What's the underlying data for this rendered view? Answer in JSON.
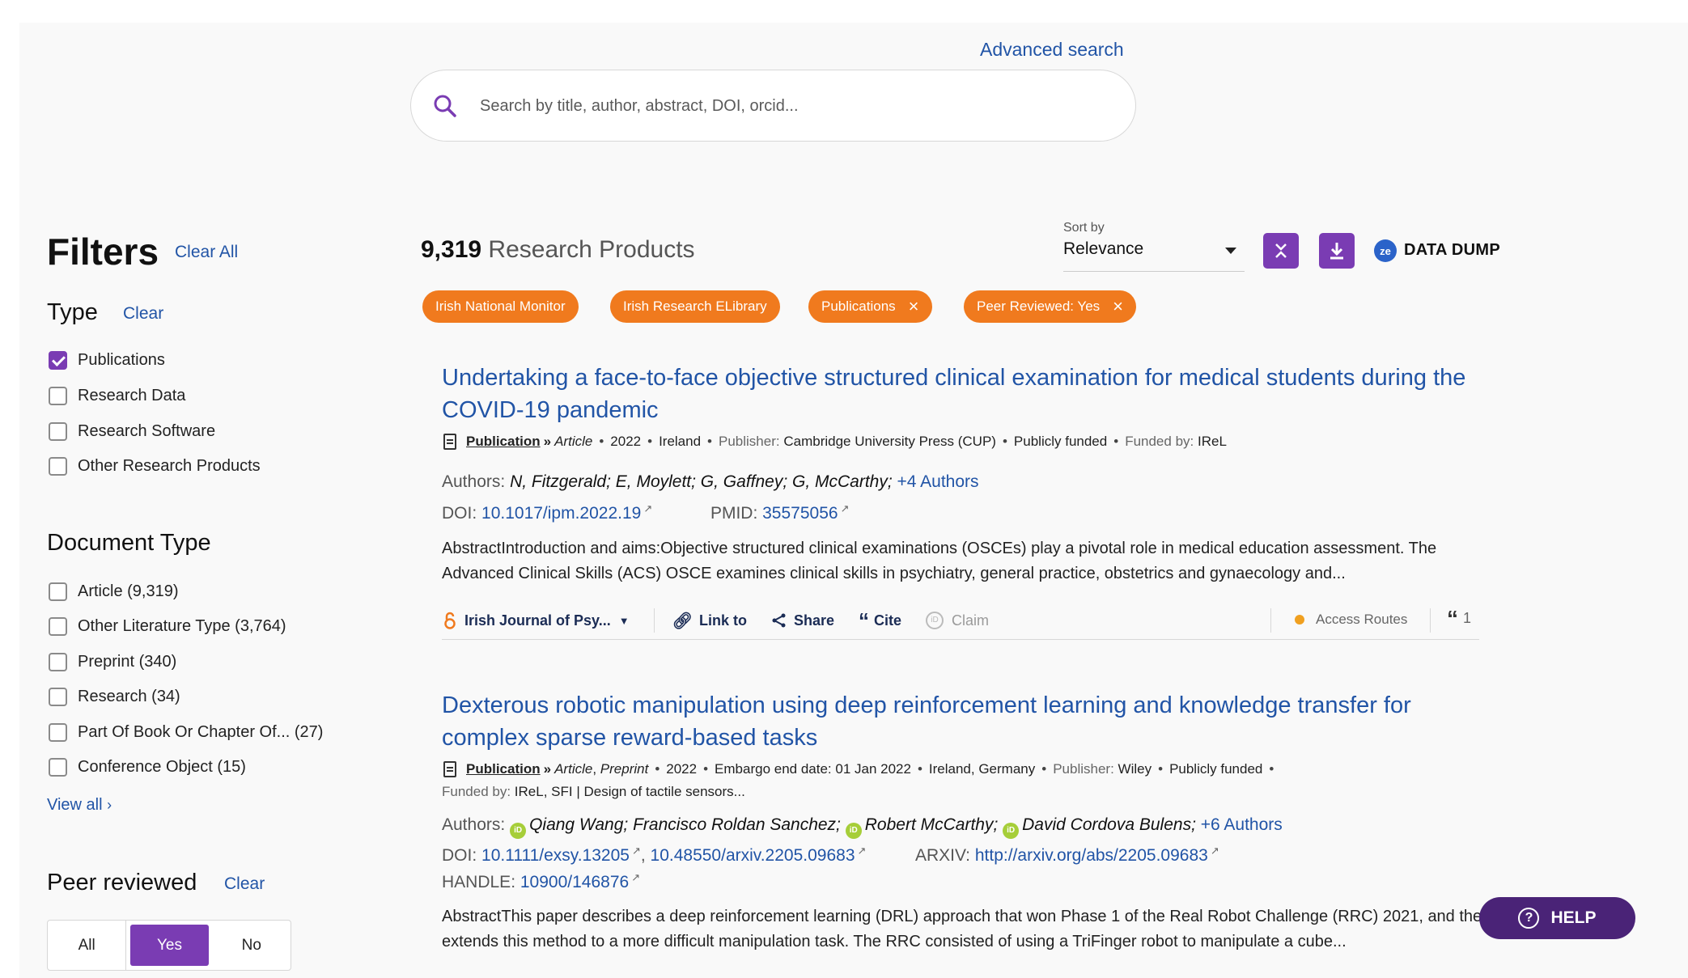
{
  "search": {
    "advanced_label": "Advanced search",
    "placeholder": "Search by title, author, abstract, DOI, orcid..."
  },
  "filters": {
    "title": "Filters",
    "clear_all": "Clear All",
    "type": {
      "title": "Type",
      "clear": "Clear",
      "options": [
        {
          "label": "Publications",
          "checked": true
        },
        {
          "label": "Research Data",
          "checked": false
        },
        {
          "label": "Research Software",
          "checked": false
        },
        {
          "label": "Other Research Products",
          "checked": false
        }
      ]
    },
    "document_type": {
      "title": "Document Type",
      "options": [
        {
          "label": "Article (9,319)"
        },
        {
          "label": "Other Literature Type (3,764)"
        },
        {
          "label": "Preprint (340)"
        },
        {
          "label": "Research (34)"
        },
        {
          "label": "Part Of Book Or Chapter Of... (27)"
        },
        {
          "label": "Conference Object (15)"
        }
      ],
      "view_all": "View all"
    },
    "peer_reviewed": {
      "title": "Peer reviewed",
      "clear": "Clear",
      "options": [
        "All",
        "Yes",
        "No"
      ],
      "selected": "Yes"
    }
  },
  "results": {
    "count": "9,319",
    "count_label": "Research Products",
    "sort_label": "Sort by",
    "sort_value": "Relevance",
    "data_dump_label": "DATA DUMP",
    "data_dump_icon": "zenodo-icon",
    "chips": [
      {
        "label": "Irish National Monitor",
        "removable": false
      },
      {
        "label": "Irish Research ELibrary",
        "removable": false
      },
      {
        "label": "Publications",
        "removable": true
      },
      {
        "label": "Peer Reviewed: Yes",
        "removable": true
      }
    ],
    "items": [
      {
        "title": "Undertaking a face-to-face objective structured clinical examination for medical students during the COVID-19 pandemic",
        "type": "Publication",
        "subtype": "Article",
        "year": "2022",
        "country": "Ireland",
        "publisher_label": "Publisher:",
        "publisher": "Cambridge University Press (CUP)",
        "funding": "Publicly funded",
        "funded_by_label": "Funded by:",
        "funded_by": "IReL",
        "authors_label": "Authors:",
        "authors": "N, Fitzgerald; E, Moylett; G, Gaffney; G, McCarthy;",
        "more_authors": "+4 Authors",
        "doi_label": "DOI:",
        "doi": "10.1017/ipm.2022.19",
        "pmid_label": "PMID:",
        "pmid": "35575056",
        "abstract": "AbstractIntroduction and aims:Objective structured clinical examinations (OSCEs) play a pivotal role in medical education assessment. The Advanced Clinical Skills (ACS) OSCE examines clinical skills in psychiatry, general practice, obstetrics and gynaecology and...",
        "source": "Irish Journal of Psy...",
        "link_to": "Link to",
        "share": "Share",
        "cite": "Cite",
        "claim": "Claim",
        "access_routes": "Access Routes",
        "citations": "1"
      },
      {
        "title": "Dexterous robotic manipulation using deep reinforcement learning and knowledge transfer for complex sparse reward-based tasks",
        "type": "Publication",
        "subtype1": "Article",
        "subtype2": "Preprint",
        "year": "2022",
        "embargo": "Embargo end date: 01 Jan 2022",
        "country": "Ireland, Germany",
        "publisher_label": "Publisher:",
        "publisher": "Wiley",
        "funding": "Publicly funded",
        "funded_by_label": "Funded by:",
        "funded_by": "IReL, SFI | Design of tactile sensors...",
        "authors_label": "Authors:",
        "author1": "Qiang Wang;",
        "author2": "Francisco Roldan Sanchez;",
        "author3": "Robert McCarthy;",
        "author4": "David Cordova Bulens;",
        "more_authors": "+6 Authors",
        "doi_label": "DOI:",
        "doi1": "10.1111/exsy.13205",
        "doi2": "10.48550/arxiv.2205.09683",
        "arxiv_label": "ARXIV:",
        "arxiv": "http://arxiv.org/abs/2205.09683",
        "handle_label": "HANDLE:",
        "handle": "10900/146876",
        "abstract": "AbstractThis paper describes a deep reinforcement learning (DRL) approach that won Phase 1 of the Real Robot Challenge (RRC) 2021, and then extends this method to a more difficult manipulation task. The RRC consisted of using a TriFinger robot to manipulate a cube..."
      }
    ]
  },
  "help_label": "HELP",
  "colors": {
    "accent_purple": "#7a3cb3",
    "chip_orange": "#f07a1e",
    "link_blue": "#2154a6",
    "help_purple": "#4a2377"
  }
}
